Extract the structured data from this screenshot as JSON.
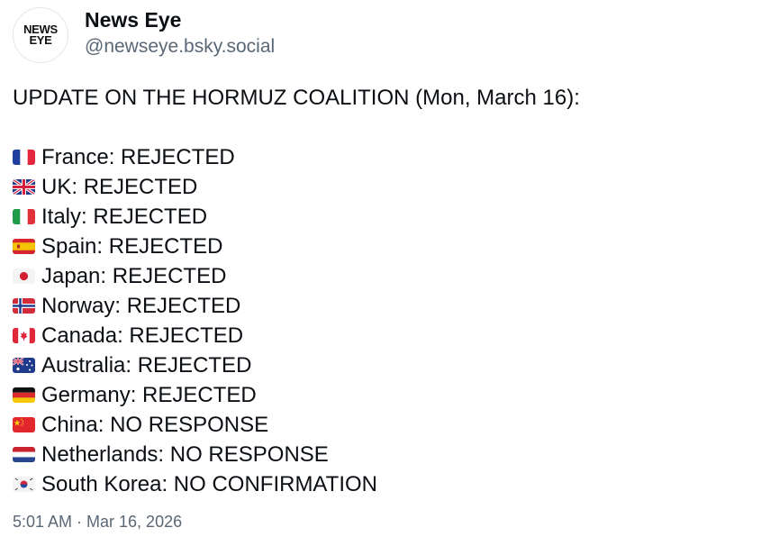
{
  "author": {
    "avatar_text": "NEWS EYE",
    "display_name": "News Eye",
    "handle": "@newseye.bsky.social"
  },
  "post": {
    "headline": "UPDATE ON THE HORMUZ COALITION (Mon, March 16):",
    "lines": [
      {
        "country": "France",
        "status": "REJECTED",
        "flag": "france-flag-icon"
      },
      {
        "country": "UK",
        "status": "REJECTED",
        "flag": "uk-flag-icon"
      },
      {
        "country": "Italy",
        "status": "REJECTED",
        "flag": "italy-flag-icon"
      },
      {
        "country": "Spain",
        "status": "REJECTED",
        "flag": "spain-flag-icon"
      },
      {
        "country": "Japan",
        "status": "REJECTED",
        "flag": "japan-flag-icon"
      },
      {
        "country": "Norway",
        "status": "REJECTED",
        "flag": "norway-flag-icon"
      },
      {
        "country": "Canada",
        "status": "REJECTED",
        "flag": "canada-flag-icon"
      },
      {
        "country": "Australia",
        "status": "REJECTED",
        "flag": "australia-flag-icon"
      },
      {
        "country": "Germany",
        "status": "REJECTED",
        "flag": "germany-flag-icon"
      },
      {
        "country": "China",
        "status": "NO RESPONSE",
        "flag": "china-flag-icon"
      },
      {
        "country": "Netherlands",
        "status": "NO RESPONSE",
        "flag": "netherlands-flag-icon"
      },
      {
        "country": "South Korea",
        "status": "NO CONFIRMATION",
        "flag": "south-korea-flag-icon"
      }
    ],
    "timestamp": "5:01 AM · Mar 16, 2026"
  },
  "colors": {
    "text": "#0b0f14",
    "muted": "#5a6776"
  }
}
